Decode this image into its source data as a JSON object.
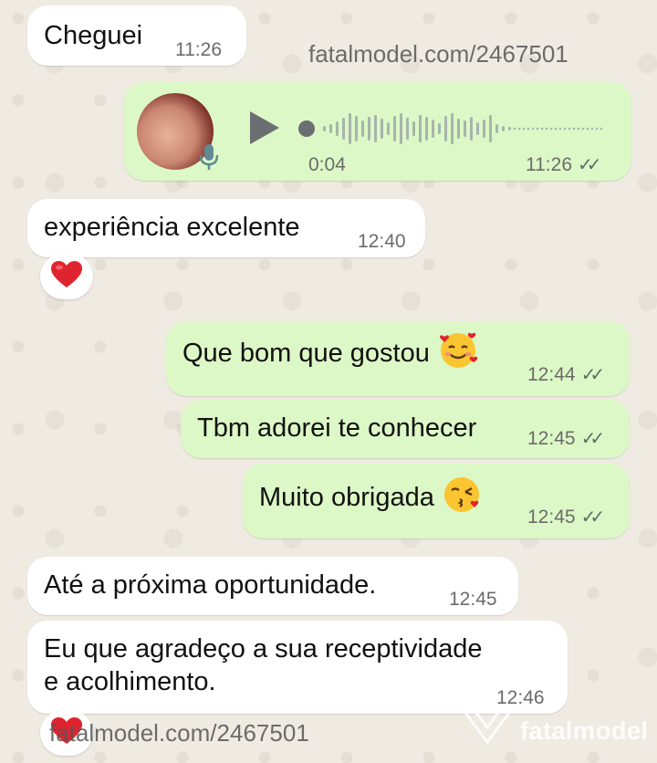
{
  "messages": [
    {
      "direction": "incoming",
      "text": "Cheguei",
      "time": "11:26"
    },
    {
      "direction": "incoming",
      "text": "experiência excelente",
      "time": "12:40",
      "reaction": "heart-icon"
    },
    {
      "direction": "outgoing",
      "text": "Que bom que gostou",
      "emoji": "smiling-face-with-hearts-icon",
      "time": "12:44",
      "status": "read"
    },
    {
      "direction": "outgoing",
      "text": "Tbm adorei te conhecer",
      "time": "12:45",
      "status": "read"
    },
    {
      "direction": "outgoing",
      "text": "Muito obrigada",
      "emoji": "face-blowing-a-kiss-icon",
      "time": "12:45",
      "status": "read"
    },
    {
      "direction": "incoming",
      "text": "Até a próxima oportunidade.",
      "time": "12:45"
    },
    {
      "direction": "incoming",
      "line1": "Eu que agradeço a sua receptividade",
      "line2": "e acolhimento.",
      "time": "12:46",
      "reaction": "heart-icon"
    }
  ],
  "voice": {
    "duration": "0:04",
    "time": "11:26",
    "status": "read",
    "progress": 0
  },
  "watermarks": [
    "fatalmodel.com/2467501",
    "fatalmodel.com/2467501"
  ],
  "brand": "fatalmodel",
  "colors": {
    "incoming_bubble": "#ffffff",
    "outgoing_bubble": "#dcf8c6",
    "wallpaper": "#efeae2",
    "heart": "#e0242f",
    "timestamp": "#6b6b6b"
  }
}
